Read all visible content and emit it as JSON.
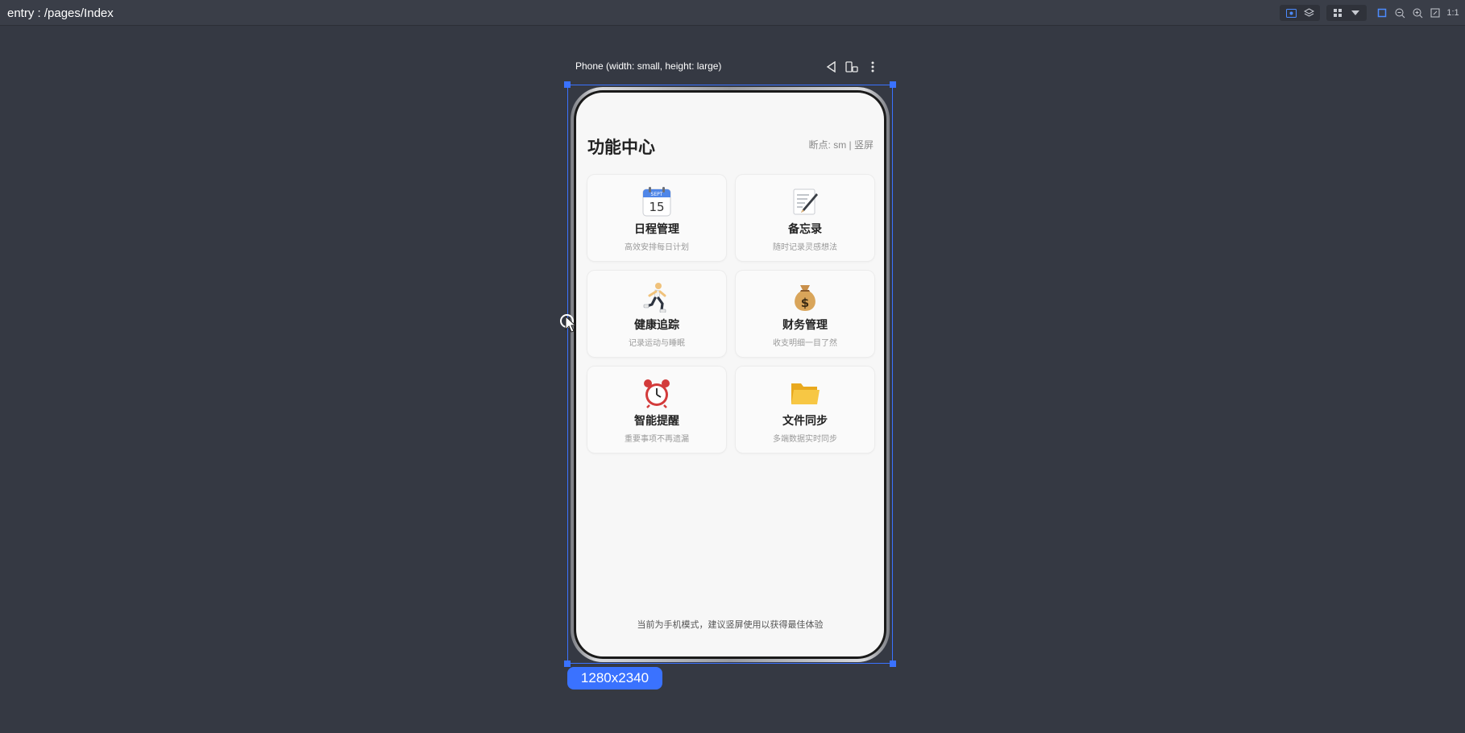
{
  "topbar": {
    "route": "entry : /pages/Index",
    "tools": [
      "inspect-icon",
      "layers-icon",
      "grid-icon",
      "dropdown-icon",
      "frame-icon",
      "zoom-out-icon",
      "zoom-in-icon",
      "fit-icon",
      "ratio-icon"
    ],
    "ratio_label": "1:1"
  },
  "device": {
    "title": "Phone (width: small, height: large)",
    "size_badge": "1280x2340"
  },
  "app": {
    "title": "功能中心",
    "breakpoint": "断点: sm | 竖屏",
    "cards": [
      {
        "icon": "calendar-icon",
        "title": "日程管理",
        "subtitle": "高效安排每日计划"
      },
      {
        "icon": "memo-icon",
        "title": "备忘录",
        "subtitle": "随时记录灵感想法"
      },
      {
        "icon": "runner-icon",
        "title": "健康追踪",
        "subtitle": "记录运动与睡眠"
      },
      {
        "icon": "money-bag-icon",
        "title": "财务管理",
        "subtitle": "收支明细一目了然"
      },
      {
        "icon": "alarm-clock-icon",
        "title": "智能提醒",
        "subtitle": "重要事项不再遗漏"
      },
      {
        "icon": "folder-icon",
        "title": "文件同步",
        "subtitle": "多端数据实时同步"
      }
    ],
    "footer": "当前为手机模式，建议竖屏使用以获得最佳体验"
  },
  "colors": {
    "background": "#353943",
    "accent": "#3a72ff",
    "screen_bg": "#f7f7f7"
  }
}
